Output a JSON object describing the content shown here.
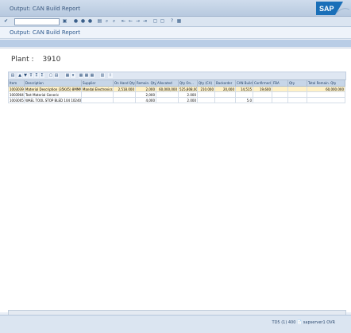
{
  "window": {
    "title": "Output: CAN Build Report"
  },
  "app": {
    "title": "Output: CAN Build Report"
  },
  "plant": {
    "label": "Plant :",
    "value": "3910"
  },
  "table": {
    "headers": [
      "Item",
      "Description",
      "Supplier",
      "On Hand Qty",
      "Remain. Qty",
      "Allocated",
      "Qty On...",
      "Qty (CA)",
      "Backorder",
      "CAN Build",
      "Confirmed",
      "FBA",
      "Qty",
      "Total Remain. Qty"
    ],
    "rows": [
      [
        "10030396",
        "Material Description (35K45) 8MMM",
        "Mandal Electronics S",
        "2,518.000",
        "2,000",
        "60,000,000",
        "525,808,000",
        "210.000",
        "20,000",
        "14,515",
        "19,600",
        "",
        "",
        "60,000.000"
      ],
      [
        "10039044",
        "Test Material Generic",
        "",
        "",
        "2,000",
        "",
        "2.000",
        "",
        "",
        "",
        "",
        "",
        "",
        ""
      ],
      [
        "10030050",
        "WAEL TOOL STOP BLED 104 102400 1000 10P",
        "",
        "",
        "4,000",
        "",
        "2.000",
        "",
        "",
        "5.0",
        "",
        "",
        "",
        ""
      ]
    ]
  },
  "status": {
    "text": "TD5 (1) 400  📄  sapserver1  OVR"
  }
}
